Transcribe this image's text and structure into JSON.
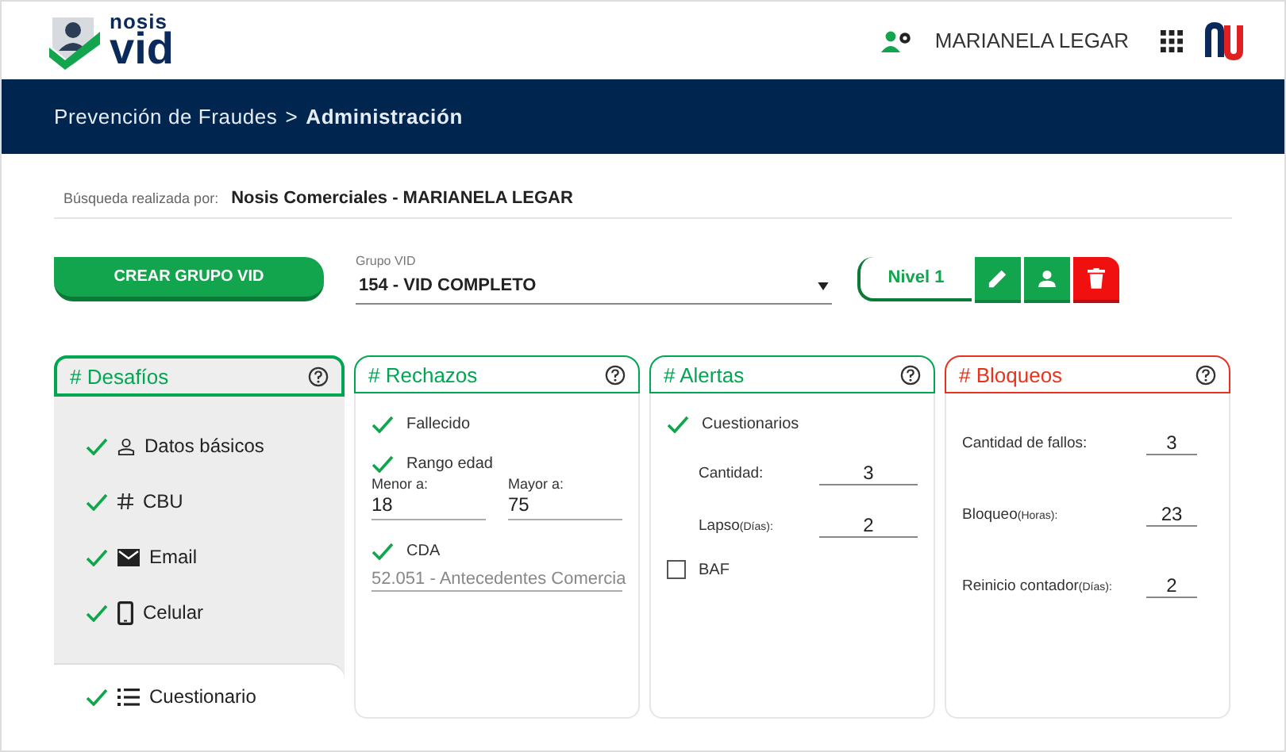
{
  "header": {
    "logo_small": "nosis",
    "logo_big": "vid",
    "user": "MARIANELA LEGAR"
  },
  "breadcrumb": {
    "parent": "Prevención de Fraudes",
    "separator": ">",
    "current": "Administración"
  },
  "search_info": {
    "label": "Búsqueda realizada por:",
    "value": "Nosis Comerciales -  MARIANELA LEGAR"
  },
  "toolbar": {
    "create_button": "CREAR GRUPO VID",
    "group_select": {
      "label": "Grupo VID",
      "value": "154 - VID COMPLETO"
    },
    "level_button": "Nivel 1"
  },
  "panels": [
    {
      "kind": "challenges",
      "title": "# Desafíos",
      "color": "#00a651",
      "selected": true,
      "items": [
        {
          "kind": "person",
          "label": "Datos básicos",
          "checked": true,
          "selected": false
        },
        {
          "kind": "hash",
          "label": "CBU",
          "checked": true,
          "selected": false
        },
        {
          "kind": "mail",
          "label": "Email",
          "checked": true,
          "selected": false
        },
        {
          "kind": "phone",
          "label": "Celular",
          "checked": true,
          "selected": false
        },
        {
          "kind": "list",
          "label": "Cuestionario",
          "checked": true,
          "selected": true
        }
      ]
    },
    {
      "kind": "rejections",
      "title": "# Rechazos",
      "color": "#00a651",
      "selected": false,
      "items": [
        {
          "label": "Fallecido",
          "checked": true
        },
        {
          "label": "Rango edad",
          "checked": true,
          "fields": [
            {
              "label": "Menor a:",
              "value": "18"
            },
            {
              "label": "Mayor a:",
              "value": "75"
            }
          ]
        },
        {
          "label": "CDA",
          "checked": true,
          "select": "52.051 - Antecedentes Comercia"
        }
      ]
    },
    {
      "kind": "alerts",
      "title": "# Alertas",
      "color": "#00a651",
      "selected": false,
      "items": [
        {
          "label": "Cuestionarios",
          "checked": true,
          "fields": [
            {
              "label": "Cantidad:",
              "value": "3"
            },
            {
              "label": "Lapso",
              "unit": "(Días):",
              "value": "2"
            }
          ]
        },
        {
          "label": "BAF",
          "checked": false
        }
      ]
    },
    {
      "kind": "blocks",
      "title": "# Bloqueos",
      "color": "#e8321e",
      "selected": false,
      "fields": [
        {
          "label": "Cantidad de fallos:",
          "value": "3"
        },
        {
          "label": "Bloqueo",
          "unit": "(Horas):",
          "value": "23"
        },
        {
          "label": "Reinicio contador",
          "unit": "(Días):",
          "value": "2"
        }
      ]
    }
  ]
}
